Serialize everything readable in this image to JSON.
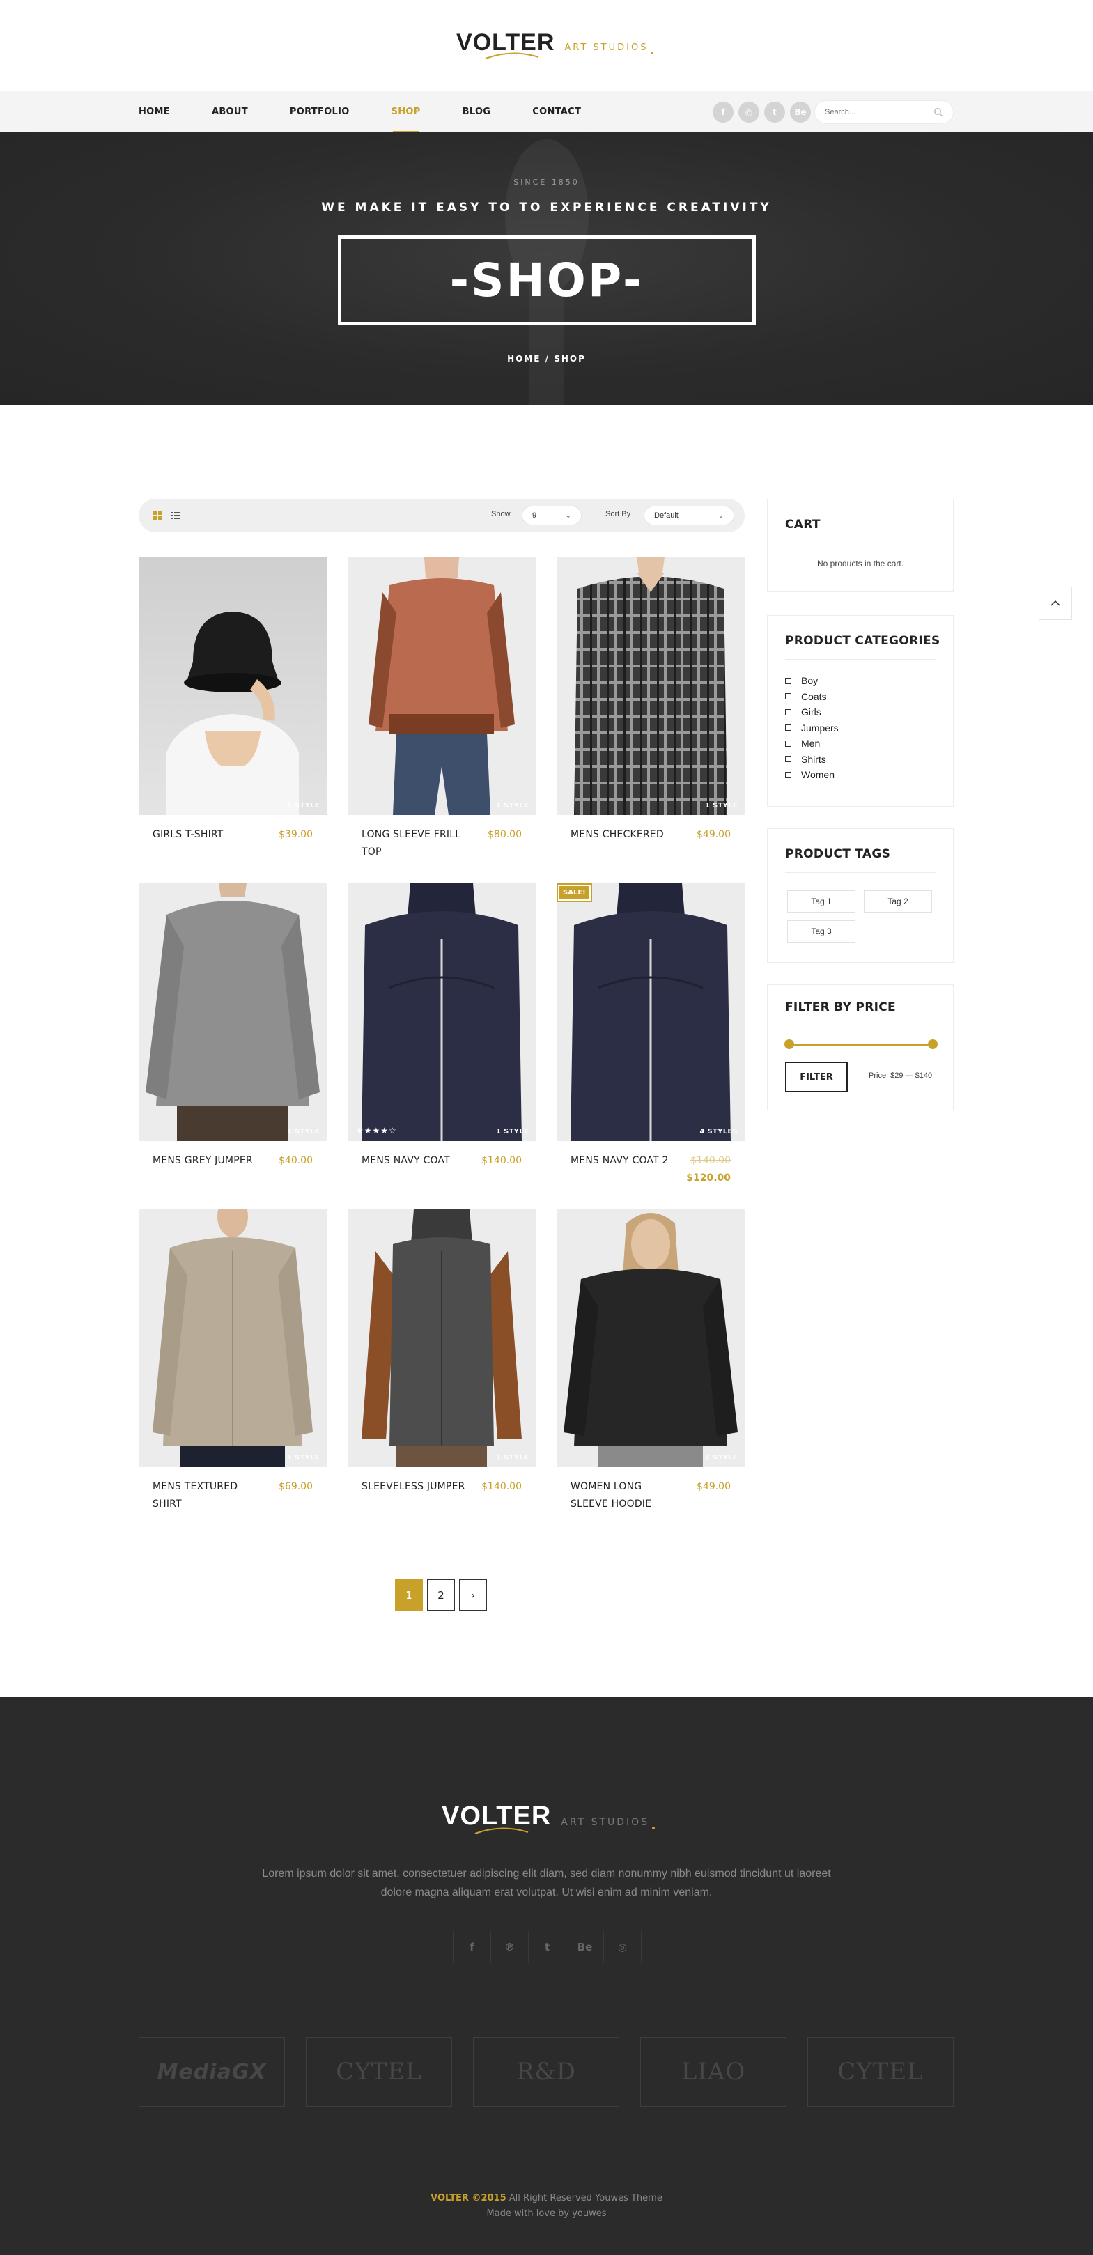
{
  "brand": {
    "name": "VOLTER",
    "sub": "ART STUDIOS"
  },
  "nav": {
    "items": [
      "HOME",
      "ABOUT",
      "PORTFOLIO",
      "SHOP",
      "BLOG",
      "CONTACT"
    ],
    "active": "SHOP",
    "social": [
      "f",
      "◎",
      "t",
      "Be"
    ],
    "search_placeholder": "Search..."
  },
  "hero": {
    "since": "SINCE 1850",
    "tagline": "WE MAKE IT EASY TO TO EXPERIENCE CREATIVITY",
    "title": "-SHOP-",
    "breadcrumb": "HOME / SHOP"
  },
  "toolbar": {
    "show_label": "Show",
    "show_value": "9",
    "sort_label": "Sort By",
    "sort_value": "Default"
  },
  "products": [
    {
      "name": "GIRLS T-SHIRT",
      "price": "$39.00",
      "styles": "1 STYLE"
    },
    {
      "name": "LONG SLEEVE FRILL TOP",
      "price": "$80.00",
      "styles": "1 STYLE"
    },
    {
      "name": "MENS CHECKERED",
      "price": "$49.00",
      "styles": "1 STYLE"
    },
    {
      "name": "MENS GREY JUMPER",
      "price": "$40.00",
      "styles": "1 STYLE"
    },
    {
      "name": "MENS NAVY COAT",
      "price": "$140.00",
      "styles": "1 STYLE",
      "stars": "★★★★☆",
      "rating": 4
    },
    {
      "name": "MENS NAVY COAT 2",
      "price": "$120.00",
      "old_price": "$140.00",
      "styles": "4 STYLES",
      "badge": "SALE!"
    },
    {
      "name": "MENS TEXTURED SHIRT",
      "price": "$69.00",
      "styles": "1 STYLE"
    },
    {
      "name": "SLEEVELESS JUMPER",
      "price": "$140.00",
      "styles": "1 STYLE"
    },
    {
      "name": "WOMEN LONG SLEEVE HOODIE",
      "price": "$49.00",
      "styles": "1 STYLE"
    }
  ],
  "pagination": {
    "pages": [
      "1",
      "2"
    ],
    "current": "1",
    "next": "›"
  },
  "sidebar": {
    "cart": {
      "title": "CART",
      "empty": "No products in the cart."
    },
    "categories": {
      "title": "PRODUCT CATEGORIES",
      "items": [
        "Boy",
        "Coats",
        "Girls",
        "Jumpers",
        "Men",
        "Shirts",
        "Women"
      ]
    },
    "tags": {
      "title": "PRODUCT TAGS",
      "items": [
        "Tag 1",
        "Tag 2",
        "Tag 3"
      ]
    },
    "filter": {
      "title": "FILTER BY PRICE",
      "button": "FILTER",
      "range": "Price: $29 — $140"
    }
  },
  "footer": {
    "text": "Lorem ipsum dolor sit amet, consectetuer adipiscing elit diam, sed diam nonummy nibh euismod tincidunt ut laoreet dolore magna aliquam erat volutpat. Ut wisi enim ad minim veniam.",
    "social": [
      "f",
      "℗",
      "t",
      "Be",
      "◎"
    ],
    "partners": [
      "MediaGX",
      "CYTEL",
      "R&D",
      "LIAO",
      "CYTEL"
    ],
    "copy_brand": "VOLTER ©2015",
    "copy_rest": " All Right Reserved Youwes Theme",
    "made_with": "Made with love by youwes"
  },
  "colors": {
    "accent": "#c8a12b",
    "dark": "#2b2b2b"
  }
}
